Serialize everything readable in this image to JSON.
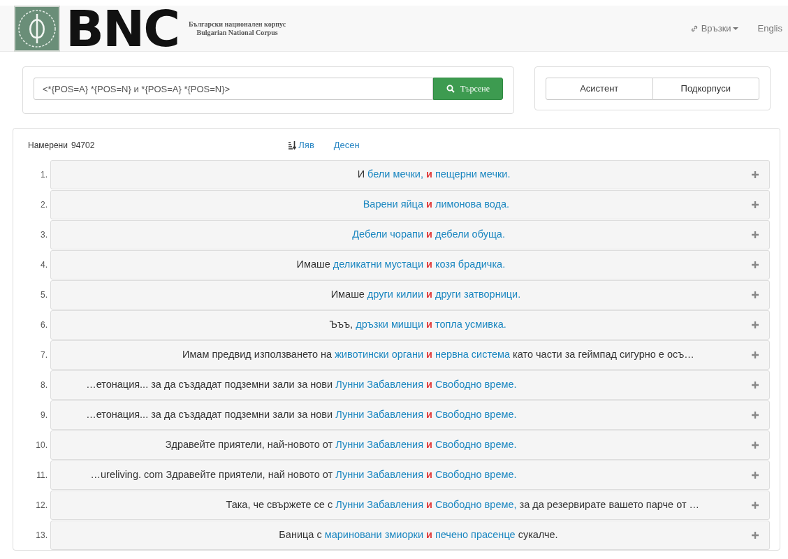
{
  "navbar": {
    "logo_text": "BNC",
    "title_bg": "Български национален корпус",
    "title_en": "Bulgarian National Corpus",
    "links": [
      {
        "label": "Връзки",
        "kind": "dropdown"
      },
      {
        "label": "Englis",
        "kind": "plain"
      }
    ]
  },
  "search": {
    "query": "<*{POS=A} *{POS=N} и *{POS=A} *{POS=N}>",
    "button": "Търсене",
    "tools": [
      "Асистент",
      "Подкорпуси"
    ]
  },
  "results": {
    "found_label": "Намерени",
    "found_count": "94702",
    "sort_options": [
      {
        "label": "Ляв",
        "selected": true
      },
      {
        "label": "Десен",
        "selected": false
      }
    ],
    "rows": [
      {
        "number": "1.",
        "left": "И",
        "hit_before": "бели мечки,",
        "keyword": "и",
        "hit_after": "пещерни мечки."
      },
      {
        "number": "2.",
        "hit_before": "Варени яйца",
        "keyword": "и",
        "hit_after": "лимонова вода."
      },
      {
        "number": "3.",
        "hit_before": "Дебели чорапи",
        "keyword": "и",
        "hit_after": "дебели обуща."
      },
      {
        "number": "4.",
        "left": "Имаше",
        "hit_before": "деликатни мустаци",
        "keyword": "и",
        "hit_after": "козя брадичка."
      },
      {
        "number": "5.",
        "left": "Имаше",
        "hit_before": "други килии",
        "keyword": "и",
        "hit_after": "други затворници."
      },
      {
        "number": "6.",
        "left": "Ъъъ,",
        "hit_before": "дръзки мишци",
        "keyword": "и",
        "hit_after": "топла усмивка."
      },
      {
        "number": "7.",
        "left": "Имам предвид използването на",
        "hit_before": "животински органи",
        "keyword": "и",
        "hit_after": "нервна система",
        "right": "като части за геймпад сигурно е осъ…"
      },
      {
        "number": "8.",
        "left": "…етонация... за да създадат подземни зали за нови",
        "hit_before": "Лунни Забавления",
        "keyword": "и",
        "hit_after": "Свободно време."
      },
      {
        "number": "9.",
        "left": "…етонация... за да създадат подземни зали за нови",
        "hit_before": "Лунни Забавления",
        "keyword": "и",
        "hit_after": "Свободно време."
      },
      {
        "number": "10.",
        "left": "Здравейте приятели, най-новото от",
        "hit_before": "Лунни Забавления",
        "keyword": "и",
        "hit_after": "Свободно време."
      },
      {
        "number": "11.",
        "left": "…ureliving. com Здравейте приятели, най новото от",
        "hit_before": "Лунни Забавления",
        "keyword": "и",
        "hit_after": "Свободно време."
      },
      {
        "number": "12.",
        "left": "Така, че свържете се с",
        "hit_before": "Лунни Забавления",
        "keyword": "и",
        "hit_after": "Свободно време,",
        "right": "за да резервирате вашето парче от …"
      },
      {
        "number": "13.",
        "left": "Баница с",
        "hit_before": "мариновани змиорки",
        "keyword": "и",
        "hit_after": "печено прасенце",
        "right": "сукалче."
      }
    ]
  }
}
